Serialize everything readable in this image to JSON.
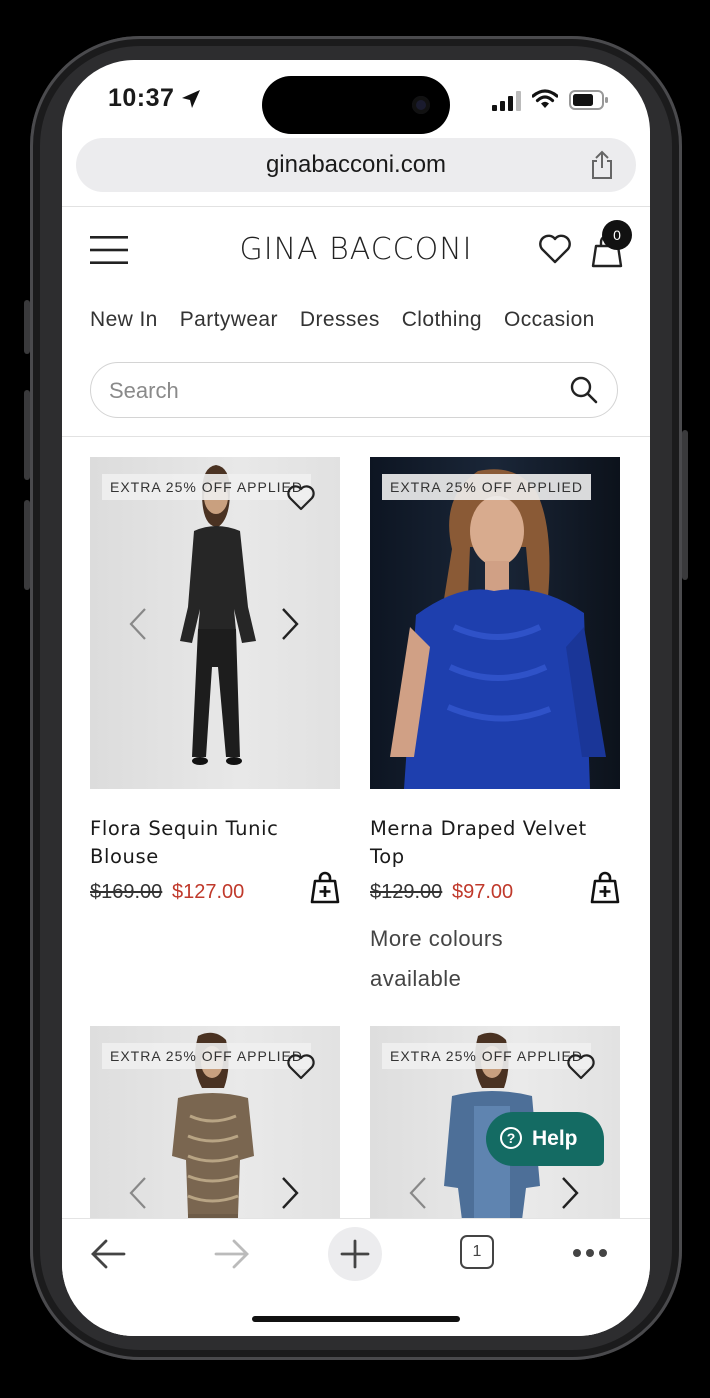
{
  "status_bar": {
    "time": "10:37"
  },
  "browser": {
    "url": "ginabacconi.com",
    "tab_count": "1"
  },
  "header": {
    "brand": "GINA BACCONI",
    "bag_count": "0"
  },
  "nav": {
    "items": [
      "New In",
      "Partywear",
      "Dresses",
      "Clothing",
      "Occasion"
    ]
  },
  "search": {
    "placeholder": "Search"
  },
  "products": [
    {
      "badge": "EXTRA 25% OFF APPLIED",
      "name": "Flora Sequin Tunic Blouse",
      "price_old": "$169.00",
      "price_new": "$127.00"
    },
    {
      "badge": "EXTRA 25% OFF APPLIED",
      "name": "Merna Draped Velvet Top",
      "price_old": "$129.00",
      "price_new": "$97.00",
      "note": "More colours available"
    },
    {
      "badge": "EXTRA 25% OFF APPLIED"
    },
    {
      "badge": "EXTRA 25% OFF APPLIED"
    }
  ],
  "help": {
    "label": "Help"
  },
  "colors": {
    "sale_price": "#c0392b",
    "help_bg": "#146b63"
  },
  "icons": [
    "location-arrow-icon",
    "signal-icon",
    "wifi-icon",
    "battery-icon",
    "share-icon",
    "menu-icon",
    "heart-icon",
    "bag-icon",
    "search-icon",
    "chevron-left-icon",
    "chevron-right-icon",
    "add-to-bag-icon",
    "question-icon",
    "back-arrow-icon",
    "forward-arrow-icon",
    "plus-icon",
    "tabs-icon",
    "more-icon"
  ]
}
